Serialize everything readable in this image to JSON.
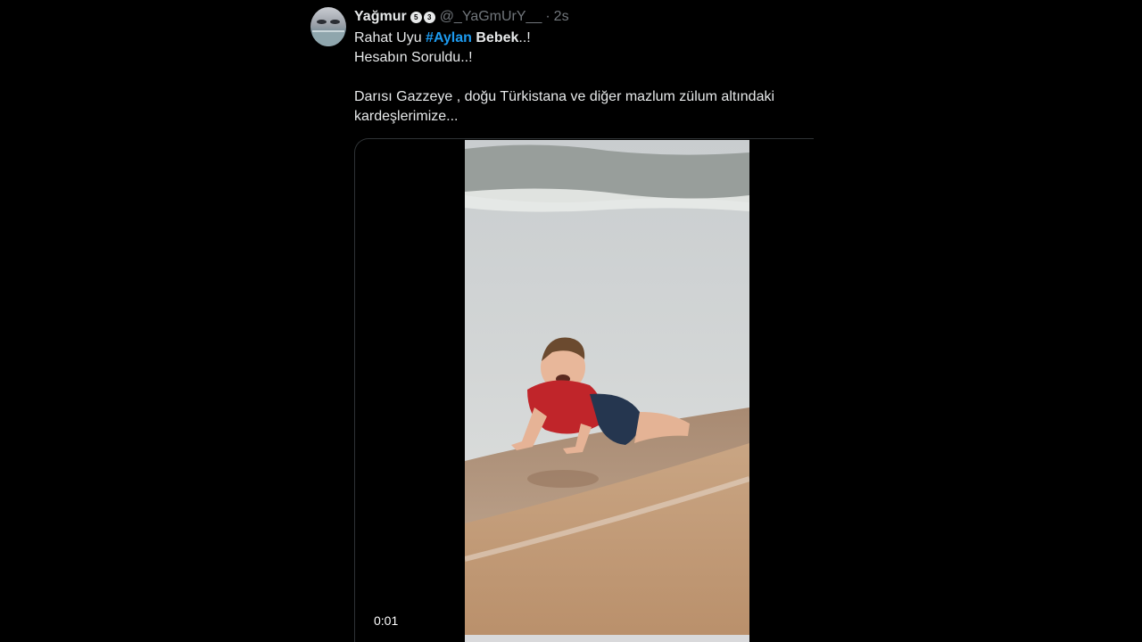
{
  "tweet": {
    "author_name": "Yağmur",
    "badges": [
      "5",
      "3"
    ],
    "handle": "@_YaGmUrY__",
    "separator": "·",
    "time": "2s",
    "line1_prefix": "Rahat Uyu ",
    "line1_hashtag": "#Aylan",
    "line1_bold": " Bebek",
    "line1_suffix": "..!",
    "line2": "Hesabın Soruldu..!",
    "line3": "Darısı Gazzeye , doğu Türkistana ve diğer mazlum  zülum altındaki kardeşlerimize..."
  },
  "video": {
    "timestamp": "0:01",
    "progress": 0.0
  },
  "colors": {
    "background": "#000000",
    "text": "#e7e9ea",
    "muted": "#71767b",
    "hashtag": "#1d9bf0",
    "border": "#2f3336"
  }
}
